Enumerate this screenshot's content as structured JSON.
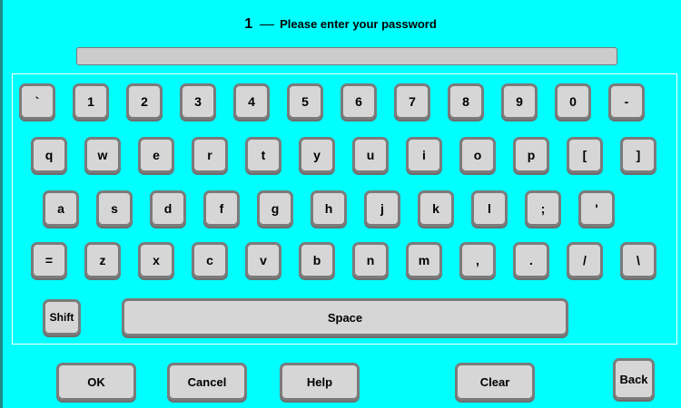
{
  "header": {
    "step": "1",
    "prompt": "Please enter your password"
  },
  "password_field": {
    "value": ""
  },
  "keyboard": {
    "rows": [
      [
        "`",
        "1",
        "2",
        "3",
        "4",
        "5",
        "6",
        "7",
        "8",
        "9",
        "0",
        "-"
      ],
      [
        "q",
        "w",
        "e",
        "r",
        "t",
        "y",
        "u",
        "i",
        "o",
        "p",
        "[",
        "]"
      ],
      [
        "a",
        "s",
        "d",
        "f",
        "g",
        "h",
        "j",
        "k",
        "l",
        ";",
        "'"
      ],
      [
        "=",
        "z",
        "x",
        "c",
        "v",
        "b",
        "n",
        "m",
        ",",
        ".",
        "/",
        "\\"
      ]
    ],
    "shift_label": "Shift",
    "space_label": "Space"
  },
  "buttons": {
    "ok": "OK",
    "cancel": "Cancel",
    "help": "Help",
    "clear": "Clear",
    "back": "Back"
  },
  "colors": {
    "background": "#00ffff",
    "key_fill": "#d6d6d6",
    "key_border": "#7b7b7b"
  }
}
